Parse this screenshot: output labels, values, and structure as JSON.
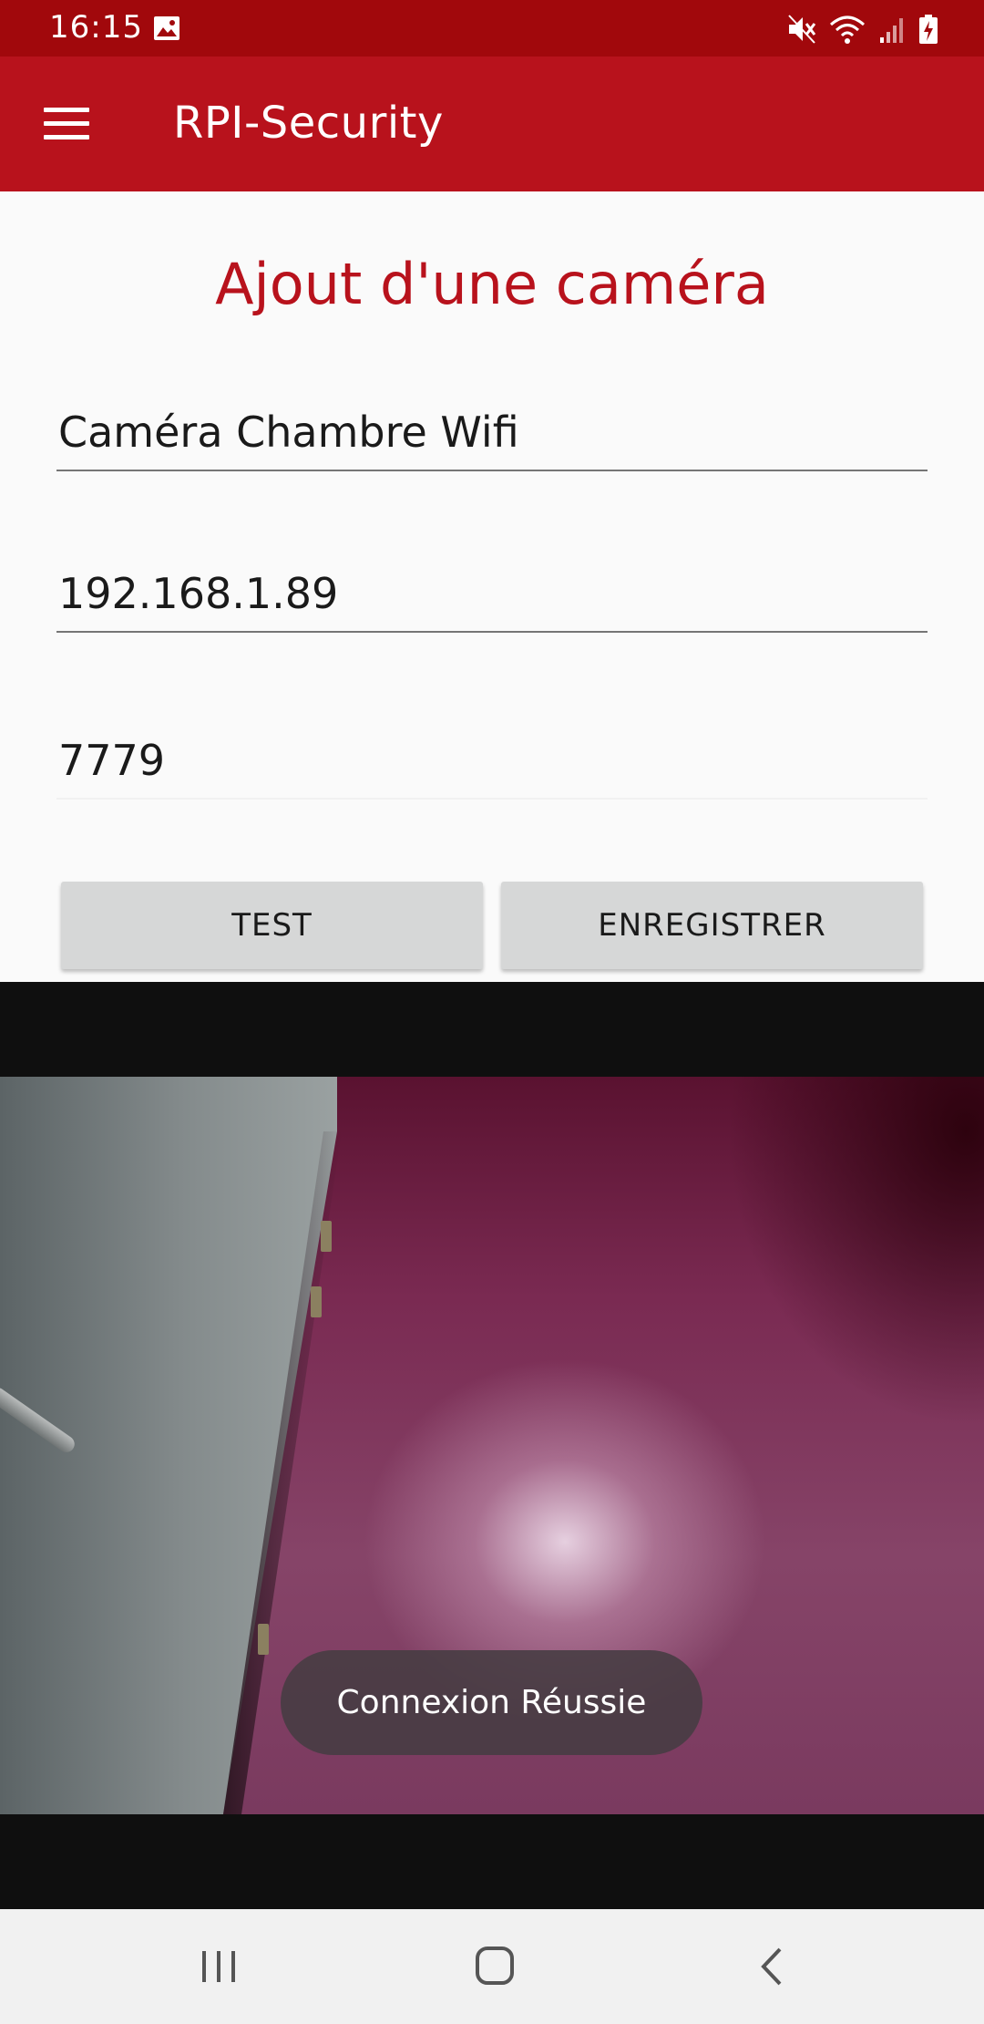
{
  "status_bar": {
    "time": "16:15",
    "icons": [
      "gallery-icon",
      "mute-icon",
      "wifi-icon",
      "signal-icon",
      "battery-charging-icon"
    ]
  },
  "app_bar": {
    "title": "RPI-Security",
    "menu_icon": "hamburger-menu-icon"
  },
  "form": {
    "title": "Ajout d'une caméra",
    "camera_name": "Caméra Chambre Wifi",
    "ip_address": "192.168.1.89",
    "port": "7779",
    "test_label": "TEST",
    "save_label": "ENREGISTRER"
  },
  "toast": {
    "message": "Connexion Réussie"
  },
  "nav_bar": {
    "icons": [
      "recents-icon",
      "home-icon",
      "back-icon"
    ]
  },
  "colors": {
    "status_bar": "#a1080c",
    "app_bar": "#b8121c",
    "accent_text": "#b8121c",
    "button_bg": "#d6d7d7"
  }
}
